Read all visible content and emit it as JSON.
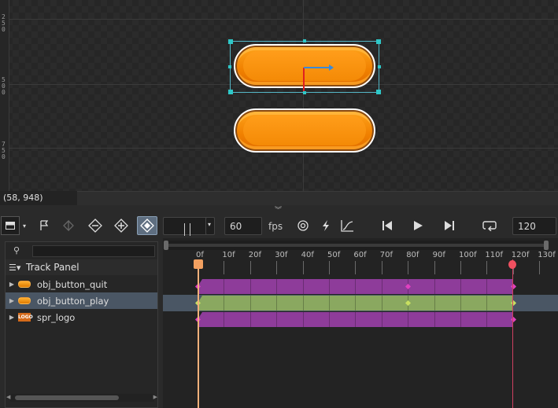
{
  "canvas": {
    "ruler_labels": [
      "250",
      "500",
      "750"
    ],
    "coords": "(58, 948)"
  },
  "toolbar": {
    "fps_value": "60",
    "fps_label": "fps",
    "length_value": "120"
  },
  "track_panel": {
    "title": "Track Panel",
    "search_placeholder": "",
    "tracks": [
      {
        "name": "obj_button_quit",
        "icon": "object-icon",
        "selected": false
      },
      {
        "name": "obj_button_play",
        "icon": "object-icon",
        "selected": true
      },
      {
        "name": "spr_logo",
        "icon": "sprite-icon",
        "selected": false
      }
    ]
  },
  "timeline": {
    "frame_labels": [
      "0f",
      "10f",
      "20f",
      "30f",
      "40f",
      "50f",
      "60f",
      "70f",
      "80f",
      "90f",
      "100f",
      "110f",
      "120f",
      "130f"
    ],
    "colors": {
      "clip_purple": "#8e3c9a",
      "clip_green": "#8aa860",
      "playhead": "#f2b07a",
      "end_marker": "#f05060"
    }
  }
}
